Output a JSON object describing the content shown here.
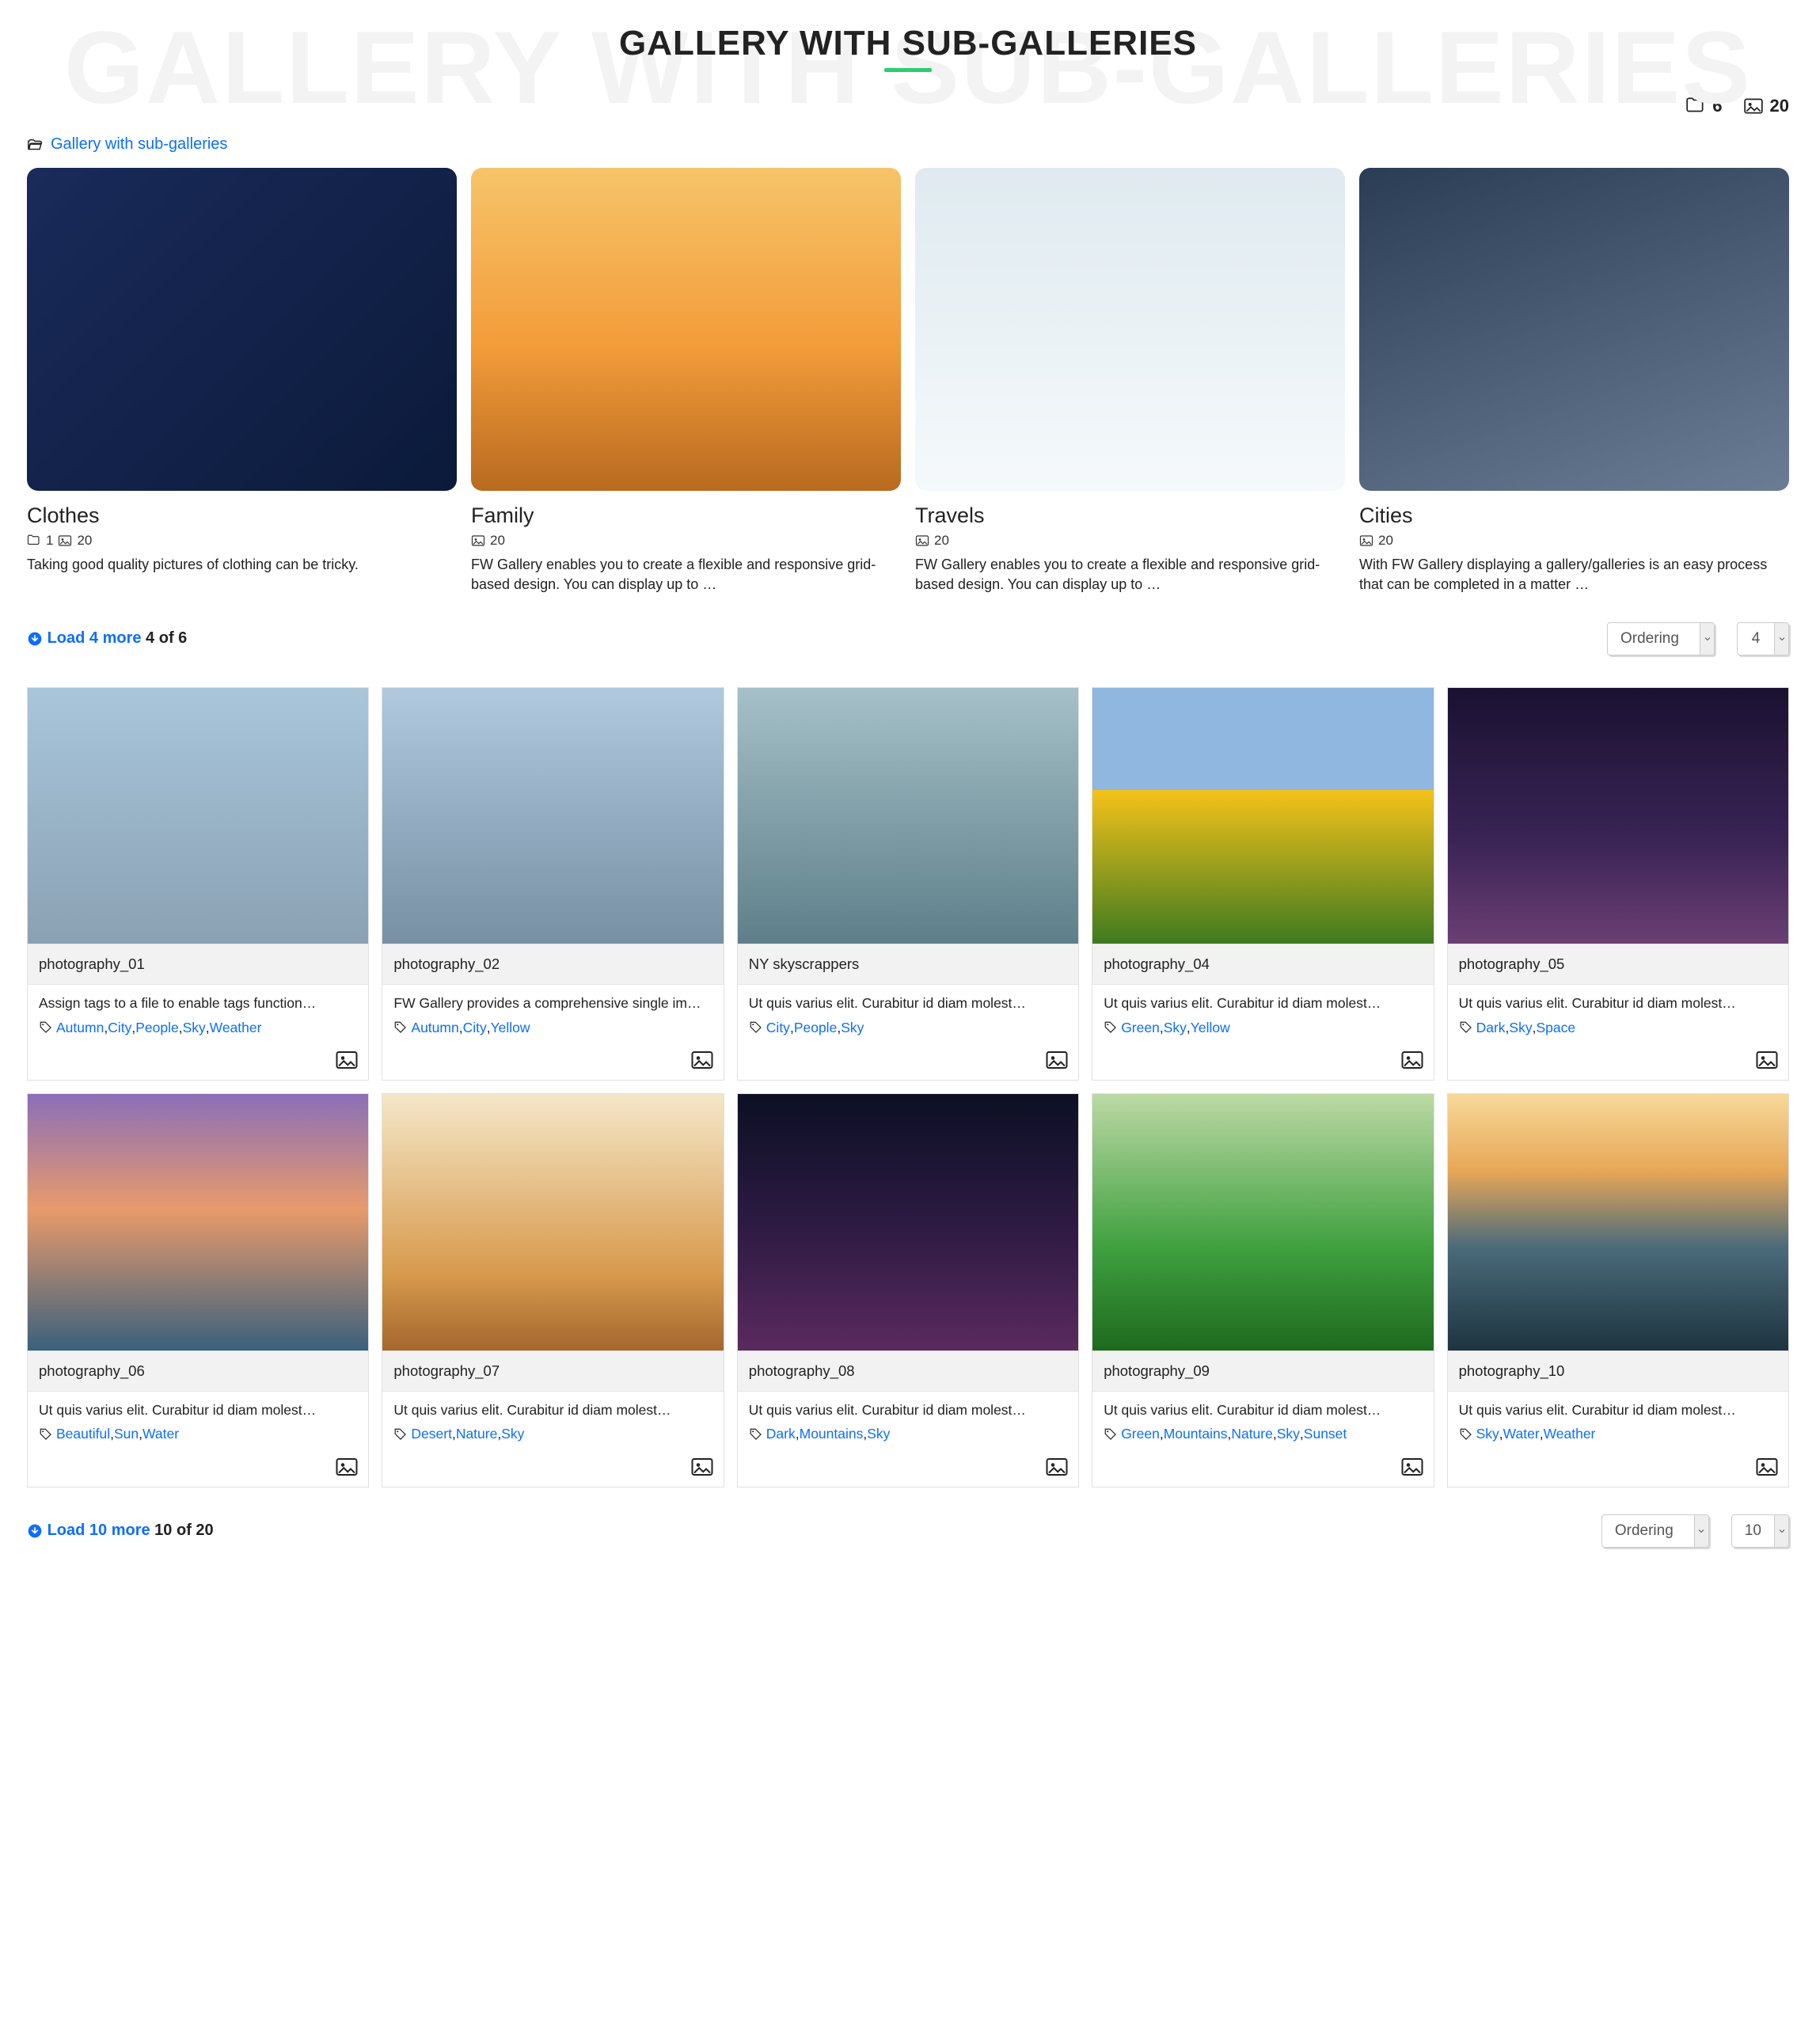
{
  "hero": {
    "title": "GALLERY WITH SUB-GALLERIES",
    "bg": "GALLERY WITH SUB-GALLERIES"
  },
  "top_stats": {
    "folders": "6",
    "images": "20"
  },
  "breadcrumb": {
    "label": "Gallery with sub-galleries"
  },
  "subgalleries": {
    "load": {
      "link": "Load 4 more",
      "of": "4 of 6"
    },
    "ordering": {
      "label": "Ordering",
      "perpage": "4"
    },
    "items": [
      {
        "title": "Clothes",
        "folders": "1",
        "images": "20",
        "desc": "Taking good quality pictures of clothing can be tricky.",
        "thumb": "g-blue"
      },
      {
        "title": "Family",
        "folders": "",
        "images": "20",
        "desc": "FW Gallery enables you to create a flexible and responsive grid-based design. You can display up to …",
        "thumb": "g-sunset"
      },
      {
        "title": "Travels",
        "folders": "",
        "images": "20",
        "desc": "FW Gallery enables you to create a flexible and responsive grid-based design. You can display up to …",
        "thumb": "g-snow"
      },
      {
        "title": "Cities",
        "folders": "",
        "images": "20",
        "desc": "With FW Gallery displaying a gallery/galleries is an easy process that can be completed in a matter …",
        "thumb": "g-city"
      }
    ]
  },
  "images": {
    "load": {
      "link": "Load 10 more",
      "of": "10 of 20"
    },
    "ordering": {
      "label": "Ordering",
      "perpage": "10"
    },
    "items": [
      {
        "title": "photography_01",
        "desc": "Assign tags to a file to enable tags function…",
        "tags": [
          "Autumn",
          "City",
          "People",
          "Sky",
          "Weather"
        ],
        "thumb": "g-street1"
      },
      {
        "title": "photography_02",
        "desc": "FW Gallery provides a comprehensive single im…",
        "tags": [
          "Autumn",
          "City",
          "Yellow"
        ],
        "thumb": "g-street2"
      },
      {
        "title": "NY skyscrappers",
        "desc": "Ut quis varius elit. Curabitur id diam molest…",
        "tags": [
          "City",
          "People",
          "Sky"
        ],
        "thumb": "g-skyscr"
      },
      {
        "title": "photography_04",
        "desc": "Ut quis varius elit. Curabitur id diam molest…",
        "tags": [
          "Green",
          "Sky",
          "Yellow"
        ],
        "thumb": "g-sunfl"
      },
      {
        "title": "photography_05",
        "desc": "Ut quis varius elit. Curabitur id diam molest…",
        "tags": [
          "Dark",
          "Sky",
          "Space"
        ],
        "thumb": "g-night"
      },
      {
        "title": "photography_06",
        "desc": "Ut quis varius elit. Curabitur id diam molest…",
        "tags": [
          "Beautiful",
          "Sun",
          "Water"
        ],
        "thumb": "g-ggate"
      },
      {
        "title": "photography_07",
        "desc": "Ut quis varius elit. Curabitur id diam molest…",
        "tags": [
          "Desert",
          "Nature",
          "Sky"
        ],
        "thumb": "g-desert"
      },
      {
        "title": "photography_08",
        "desc": "Ut quis varius elit. Curabitur id diam molest…",
        "tags": [
          "Dark",
          "Mountains",
          "Sky"
        ],
        "thumb": "g-mw"
      },
      {
        "title": "photography_09",
        "desc": "Ut quis varius elit. Curabitur id diam molest…",
        "tags": [
          "Green",
          "Mountains",
          "Nature",
          "Sky",
          "Sunset"
        ],
        "thumb": "g-green"
      },
      {
        "title": "photography_10",
        "desc": "Ut quis varius elit. Curabitur id diam molest…",
        "tags": [
          "Sky",
          "Water",
          "Weather"
        ],
        "thumb": "g-ocean"
      }
    ]
  }
}
